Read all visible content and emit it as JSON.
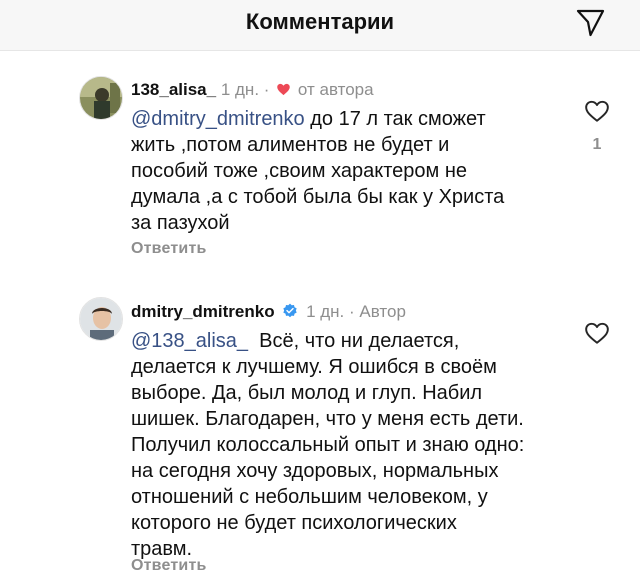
{
  "header": {
    "title": "Комментарии"
  },
  "comments": [
    {
      "username": "138_alisa_",
      "time": "1 дн.",
      "separator": "·",
      "liked_by_author_label": "от автора",
      "mention": "@dmitry_dmitrenko",
      "text": " до 17 л так сможет\nжить ,потом алиментов не будет и\nпособий тоже ,своим характером не\nдумала ,а с тобой была бы как у Христа\nза пазухой",
      "reply_label": "Ответить",
      "likes": "1"
    },
    {
      "username": "dmitry_dmitrenko",
      "time": "1 дн.",
      "separator": "·",
      "role_label": "Автор",
      "mention": "@138_alisa_",
      "text": "  Всё, что ни делается,\nделается к лучшему. Я ошибся в своём\nвыборе. Да, был молод и глуп. Набил\nшишек. Благодарен, что у меня есть дети.\nПолучил колоссальный опыт и знаю одно:\nна сегодня хочу здоровых, нормальных\nотношений с небольшим человеком, у\nкоторого не будет психологических\nтравм.",
      "reply_label": "Ответить"
    }
  ],
  "colors": {
    "heart": "#ed4956",
    "verified": "#3897f0",
    "mention": "#385185"
  },
  "icons": [
    "send-icon",
    "heart-icon",
    "verified-badge-icon",
    "like-heart-icon"
  ]
}
